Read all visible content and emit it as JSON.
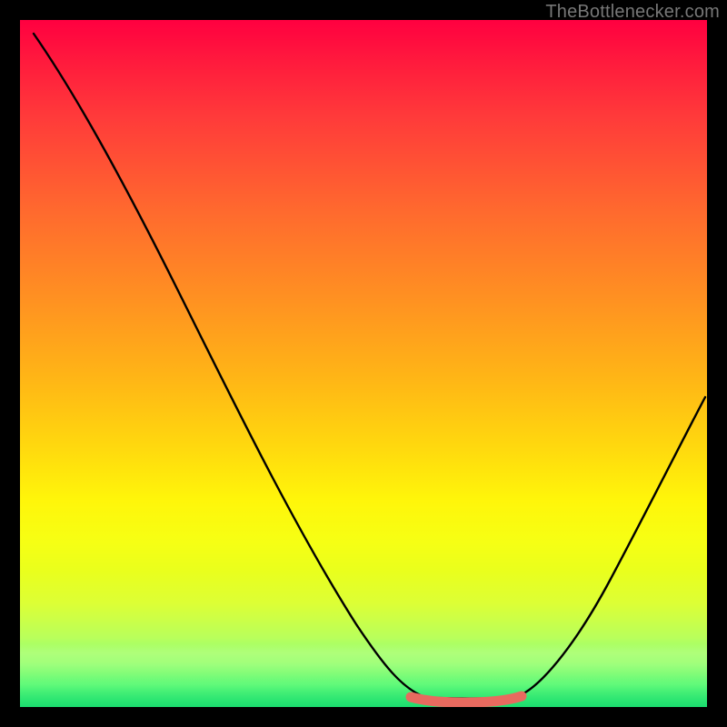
{
  "watermark": "TheBottlenecker.com",
  "chart_data": {
    "type": "line",
    "title": "",
    "xlabel": "",
    "ylabel": "",
    "xlim": [
      0,
      100
    ],
    "ylim": [
      0,
      100
    ],
    "x": [
      2,
      10,
      20,
      30,
      40,
      50,
      55,
      58,
      63,
      68,
      72,
      78,
      85,
      92,
      100
    ],
    "values": [
      98,
      85,
      70,
      54,
      38,
      20,
      10,
      4,
      1,
      0.5,
      1,
      4,
      12,
      24,
      40
    ],
    "flat_region": {
      "x_start": 56,
      "x_end": 73,
      "y": 1.2
    },
    "grid": false,
    "legend": null,
    "annotations": []
  },
  "colors": {
    "curve": "#000000",
    "marker": "#e86a5f",
    "background_top": "#ff0040",
    "background_bottom": "#00e676"
  }
}
